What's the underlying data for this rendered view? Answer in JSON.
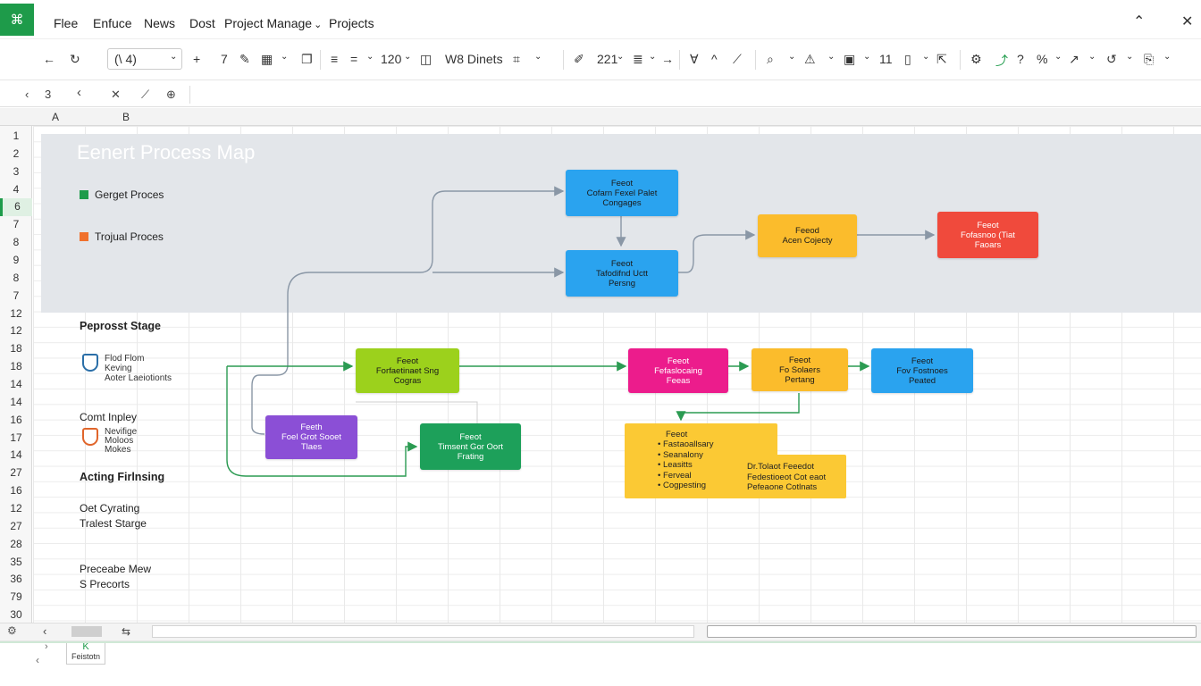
{
  "menubar": {
    "logo_glyph": "⌘",
    "items": [
      "Flee",
      "Enfuce",
      "News",
      "Dost",
      "Project Manage",
      "Projects"
    ],
    "project_manage_arrow": "⌄"
  },
  "toolbar": {
    "font_selector": "(\\   4)",
    "font_size": "120",
    "style_name": "W8 Dinets",
    "zoom": "221",
    "glyph_back": "←",
    "glyph_plus": "+",
    "glyph_seven": "7",
    "glyph_eleven": "11"
  },
  "formulabar": {
    "cell_ref": "3",
    "nav_left": "‹",
    "nav_left2": "‹",
    "cancel": "✕"
  },
  "columns": {
    "a": "A",
    "b": "B"
  },
  "rows": [
    "1",
    "2",
    "3",
    "4",
    "6",
    "7",
    "8",
    "9",
    "8",
    "7",
    "12",
    "12",
    "18",
    "18",
    "14",
    "14",
    "16",
    "17",
    "14",
    "27",
    "16",
    "12",
    "27",
    "28",
    "35",
    "36",
    "79",
    "30"
  ],
  "diagram": {
    "title": "Eenert Process Map",
    "legend": [
      {
        "label": "Gerget Proces",
        "color": "#1e9b4a"
      },
      {
        "label": "Trojual Proces",
        "color": "#f0712d"
      }
    ]
  },
  "sidebar": {
    "stage_head": "Peprosst Stage",
    "block1": [
      "Flod Flom",
      "Keving",
      "Aoter Laeiotionts"
    ],
    "count_label": "Comt Inpley",
    "block2": [
      "Nevifige",
      "Moloos",
      "Mokes"
    ],
    "acting_head": "Acting Firlnsing",
    "oct_label": "Oet Cyrating",
    "traloest": "Tralest Starge",
    "preceabe": "Preceabe Mew",
    "precorts": "S Precorts"
  },
  "nodes": {
    "n1": {
      "title": "Feeot",
      "l1": "Cofarn Fexel Palet",
      "l2": "Congages",
      "color": "#2aa3ef"
    },
    "n2": {
      "title": "Feeot",
      "l1": "Tafodifnd Uctt",
      "l2": "Persng",
      "color": "#2aa3ef"
    },
    "n3": {
      "title": "Feeod",
      "l1": "Acen Cojecty",
      "l2": "",
      "color": "#fbbc2c"
    },
    "n4": {
      "title": "Feeot",
      "l1": "Fofasnoo (Tiat",
      "l2": "Faoars",
      "color": "#f04a3c"
    },
    "n5": {
      "title": "Feeot",
      "l1": "Forfaetinaet Sng",
      "l2": "Cogras",
      "color": "#9cd11c"
    },
    "n6": {
      "title": "Feeot",
      "l1": "Fefaslocaing",
      "l2": "Feeas",
      "color": "#ec1c8c"
    },
    "n7": {
      "title": "Feeot",
      "l1": "Fo Solaers",
      "l2": "Pertang",
      "color": "#fbbc2c"
    },
    "n8": {
      "title": "Feeot",
      "l1": "Fov Fostnoes",
      "l2": "Peated",
      "color": "#2aa3ef"
    },
    "n9": {
      "title": "Feeth",
      "l1": "Foel Grot Sooet",
      "l2": "Tlaes",
      "color": "#8b4fd6"
    },
    "n10": {
      "title": "Feeot",
      "l1": "Timsent Gor Oort",
      "l2": "Frating",
      "color": "#1da05a"
    }
  },
  "yellow": {
    "title": "Feeot",
    "items": [
      "Fastaoallsary",
      "Seanalony",
      "Leasitts",
      "Ferveal",
      "Cogpesting"
    ],
    "right": [
      "Dr.Tolaot Feeedot",
      "Fedestioeot Cot eaot",
      "Pefeaone Cotlnats"
    ]
  },
  "bottom": {
    "nav_left": "‹",
    "nav_scroll": "⇆",
    "sheet_glyph": "K",
    "sheet_name": "Feistotn",
    "chevron": "›",
    "left_arrow": "‹"
  },
  "colors": {
    "accent": "#1e9b4a",
    "band": "#e3e6ea",
    "connector": "#8a97a6",
    "connector_green": "#2b9b52"
  }
}
